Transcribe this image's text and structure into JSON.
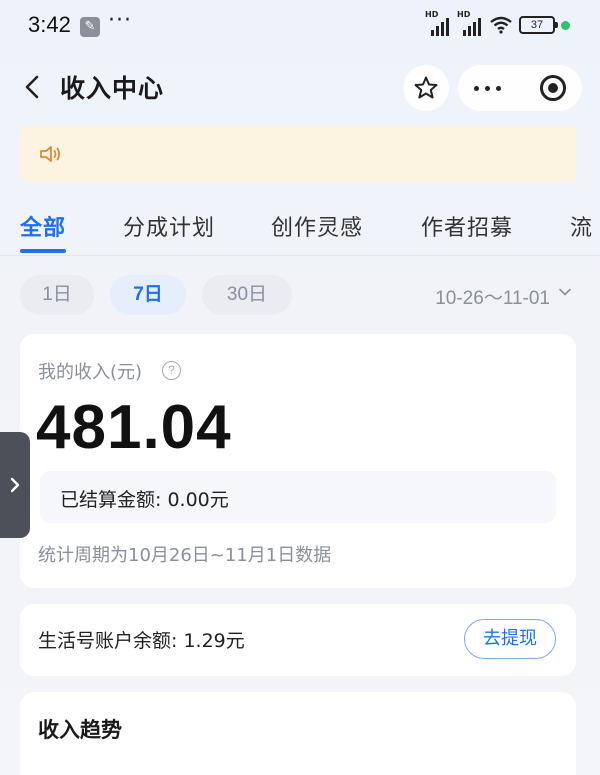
{
  "status_bar": {
    "time": "3:42",
    "dots": "···",
    "signal1_label": "HD",
    "signal2_label": "HD",
    "battery": "37"
  },
  "header": {
    "title": "收入中心"
  },
  "tabs": [
    {
      "label": "全部",
      "active": true
    },
    {
      "label": "分成计划",
      "active": false
    },
    {
      "label": "创作灵感",
      "active": false
    },
    {
      "label": "作者招募",
      "active": false
    },
    {
      "label": "流",
      "active": false
    }
  ],
  "periods": [
    {
      "label": "1日",
      "active": false
    },
    {
      "label": "7日",
      "active": true
    },
    {
      "label": "30日",
      "active": false
    }
  ],
  "date_range": "10-26～11-01",
  "income": {
    "label": "我的收入(元)",
    "help": "?",
    "amount": "481.04",
    "settled": "已结算金额: 0.00元",
    "period_note": "统计周期为10月26日~11月1日数据"
  },
  "balance": {
    "text": "生活号账户余额: 1.29元",
    "withdraw_label": "去提现"
  },
  "trend": {
    "title": "收入趋势"
  },
  "colors": {
    "accent": "#1e6ff2",
    "notice_bg": "#fdf3e1",
    "side_handle": "#4c5058"
  }
}
